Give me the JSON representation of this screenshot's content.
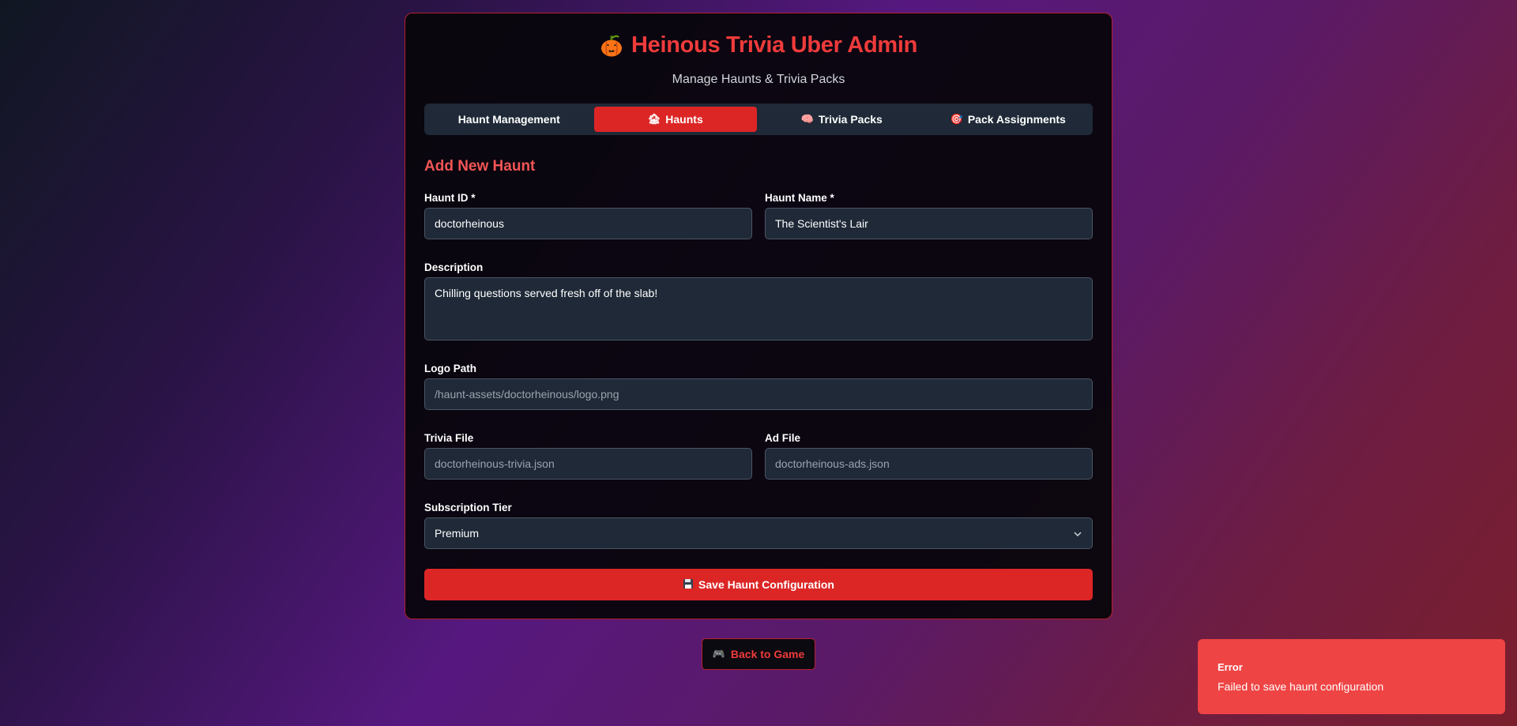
{
  "header": {
    "title": "Heinous Trivia Uber Admin",
    "subtitle": "Manage Haunts & Trivia Packs",
    "icon": "pumpkin-icon"
  },
  "tabs": [
    {
      "label": "Haunt Management",
      "icon": "",
      "active": false
    },
    {
      "label": "Haunts",
      "icon": "house-icon",
      "active": true
    },
    {
      "label": "Trivia Packs",
      "icon": "brain-icon",
      "active": false
    },
    {
      "label": "Pack Assignments",
      "icon": "target-icon",
      "active": false
    }
  ],
  "form": {
    "section_title": "Add New Haunt",
    "haunt_id": {
      "label": "Haunt ID *",
      "value": "doctorheinous"
    },
    "haunt_name": {
      "label": "Haunt Name *",
      "value": "The Scientist's Lair"
    },
    "description": {
      "label": "Description",
      "value": "Chilling questions served fresh off of the slab!"
    },
    "logo_path": {
      "label": "Logo Path",
      "placeholder": "/haunt-assets/doctorheinous/logo.png"
    },
    "trivia_file": {
      "label": "Trivia File",
      "placeholder": "doctorheinous-trivia.json"
    },
    "ad_file": {
      "label": "Ad File",
      "placeholder": "doctorheinous-ads.json"
    },
    "subscription_tier": {
      "label": "Subscription Tier",
      "value": "Premium"
    },
    "save_label": "Save Haunt Configuration"
  },
  "back_button": {
    "label": "Back to Game"
  },
  "toast": {
    "title": "Error",
    "message": "Failed to save haunt configuration"
  },
  "colors": {
    "accent": "#dc2626",
    "title": "#ef3b3b",
    "toast": "#ef4444",
    "field_bg": "#1f2937"
  }
}
